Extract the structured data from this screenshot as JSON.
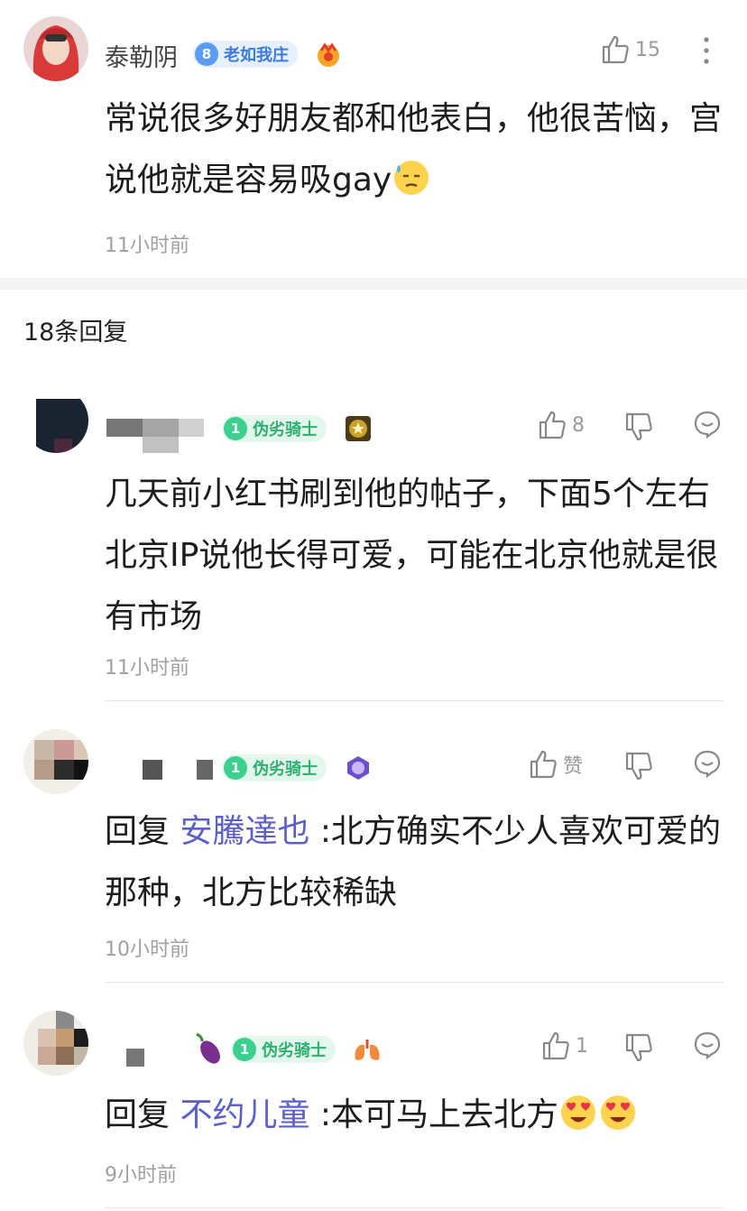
{
  "main_comment": {
    "username": "泰勒阴",
    "level": "8",
    "level_title": "老如我庄",
    "likes": "15",
    "text": "常说很多好朋友都和他表白，他很苦恼，宫说他就是容易吸gay",
    "time": "11小时前"
  },
  "replies_header": "18条回复",
  "replies": [
    {
      "level": "1",
      "level_title": "伪劣骑士",
      "likes": "8",
      "text": "几天前小红书刷到他的帖子，下面5个左右北京IP说他长得可爱，可能在北京他就是很有市场",
      "time": "11小时前"
    },
    {
      "level": "1",
      "level_title": "伪劣骑士",
      "likes": "赞",
      "reply_prefix": "回复 ",
      "reply_to": "安騰達也",
      "text": " :北方确实不少人喜欢可爱的那种，北方比较稀缺",
      "time": "10小时前"
    },
    {
      "level": "1",
      "level_title": "伪劣骑士",
      "likes": "1",
      "reply_prefix": "回复 ",
      "reply_to": "不约儿童",
      "text": " :本可马上去北方",
      "time": "9小时前"
    }
  ],
  "colors": {
    "level_blue": "#5b9cf5",
    "level_green": "#3dcf8f",
    "mention": "#5b5fc7",
    "time": "#a0a0a0"
  },
  "icons": [
    "thumb-up-icon",
    "thumb-down-icon",
    "comment-icon",
    "more-vertical-icon"
  ]
}
